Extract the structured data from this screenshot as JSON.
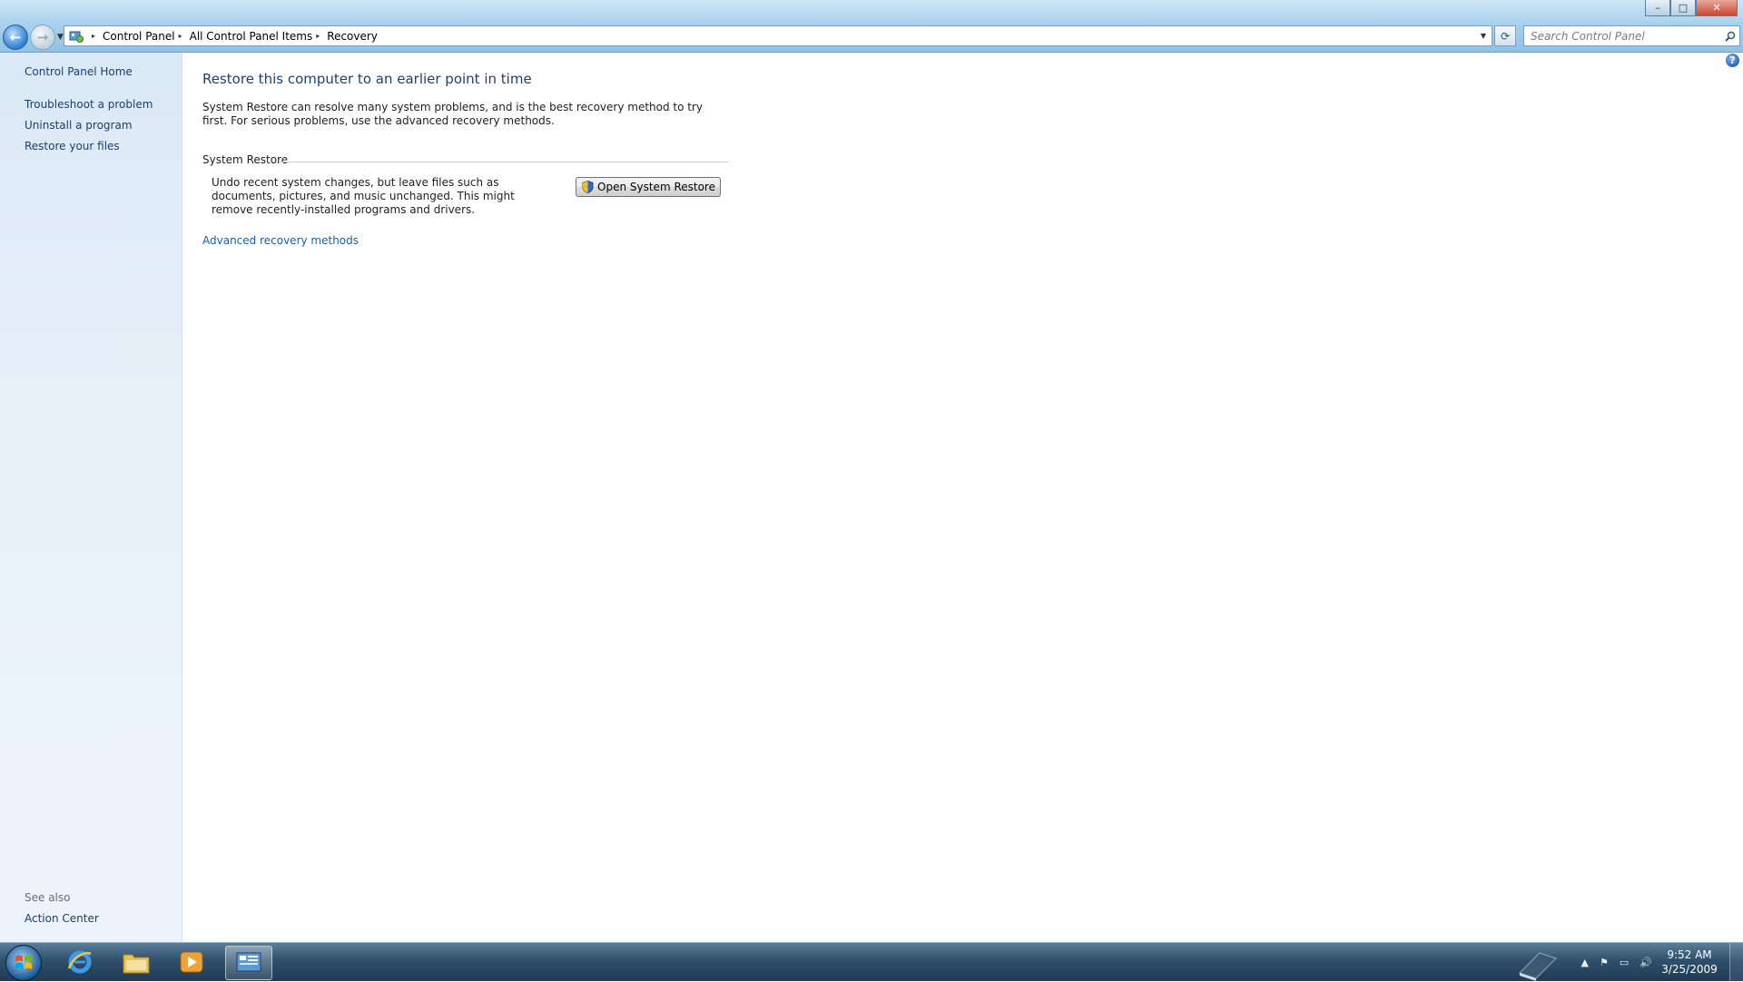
{
  "window": {
    "minimize_glyph": "–",
    "maximize_glyph": "□",
    "close_glyph": "✕"
  },
  "nav": {
    "back_glyph": "←",
    "forward_glyph": "→",
    "recent_glyph": "▼"
  },
  "address": {
    "crumbs": [
      "Control Panel",
      "All Control Panel Items",
      "Recovery"
    ],
    "separator": "▸",
    "dropdown_glyph": "▼",
    "refresh_glyph": "⟳"
  },
  "search": {
    "placeholder": "Search Control Panel"
  },
  "sidebar": {
    "home": "Control Panel Home",
    "links": [
      "Troubleshoot a problem",
      "Uninstall a program",
      "Restore your files"
    ],
    "see_also_label": "See also",
    "see_also_links": [
      "Action Center"
    ]
  },
  "main": {
    "title": "Restore this computer to an earlier point in time",
    "intro": "System Restore can resolve many system problems, and is the best recovery method to try first. For serious problems, use the advanced recovery methods.",
    "section_title": "System Restore",
    "section_desc": "Undo recent system changes, but leave files such as documents, pictures, and music unchanged. This might remove recently-installed programs and drivers.",
    "button_label": "Open System Restore",
    "advanced_link": "Advanced recovery methods",
    "help_glyph": "?"
  },
  "taskbar": {
    "time": "9:52 AM",
    "date": "3/25/2009",
    "tray_glyphs": [
      "▲",
      "⚑",
      "▭",
      "🔊"
    ]
  },
  "colors": {
    "link": "#1a3e6e",
    "title": "#1e3f7a",
    "accent_link": "#1a5fa8",
    "taskbar": "#2f506c"
  }
}
